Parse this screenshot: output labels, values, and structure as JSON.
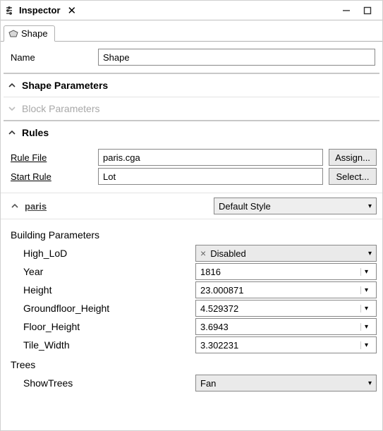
{
  "window": {
    "title": "Inspector"
  },
  "tabs": {
    "shape_label": "Shape"
  },
  "name_field": {
    "label": "Name",
    "value": "Shape"
  },
  "sections": {
    "shape_params_label": "Shape Parameters",
    "block_params_label": "Block Parameters",
    "rules_label": "Rules"
  },
  "rules": {
    "rule_file_label": "Rule File",
    "rule_file_value": "paris.cga",
    "assign_btn": "Assign...",
    "start_rule_label": "Start Rule",
    "start_rule_value": "Lot",
    "select_btn": "Select..."
  },
  "preset": {
    "name": "paris",
    "style_value": "Default Style"
  },
  "groups": {
    "building_params": "Building Parameters",
    "trees": "Trees"
  },
  "params": {
    "high_lod_label": "High_LoD",
    "high_lod_value": "Disabled",
    "year_label": "Year",
    "year_value": "1816",
    "height_label": "Height",
    "height_value": "23.000871",
    "groundfloor_label": "Groundfloor_Height",
    "groundfloor_value": "4.529372",
    "floor_height_label": "Floor_Height",
    "floor_height_value": "3.6943",
    "tile_width_label": "Tile_Width",
    "tile_width_value": "3.302231",
    "show_trees_label": "ShowTrees",
    "show_trees_value": "Fan"
  }
}
